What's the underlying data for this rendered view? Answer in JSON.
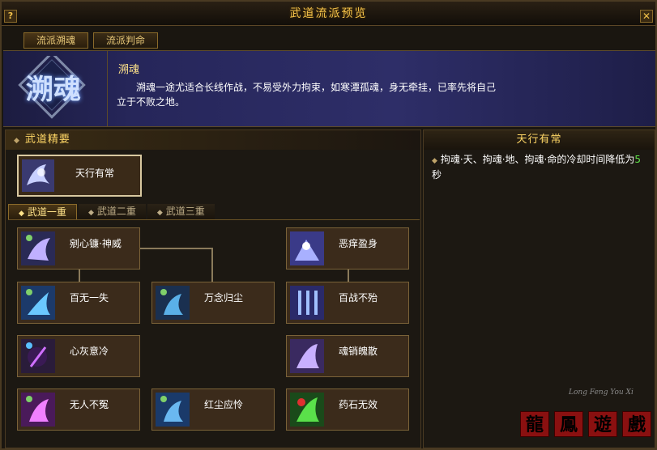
{
  "window": {
    "title": "武道流派预览",
    "help_label": "?",
    "close_label": "✕"
  },
  "tabs": [
    {
      "label": "流派溯魂",
      "active": true
    },
    {
      "label": "流派判命",
      "active": false
    }
  ],
  "school": {
    "emblem_text": "溯魂",
    "name": "溯魂",
    "description": "溯魂一途尤适合长线作战，不易受外力拘束，如寒潭孤魂，身无牵挂，已率先将自己立于不败之地。"
  },
  "essence": {
    "header": "武道精要",
    "card_label": "天行有常"
  },
  "sub_tabs": [
    {
      "label": "武道一重",
      "active": true
    },
    {
      "label": "武道二重",
      "active": false
    },
    {
      "label": "武道三重",
      "active": false
    }
  ],
  "skills": [
    {
      "label": "剜心镰·神威"
    },
    {
      "label": "恶痒盈身"
    },
    {
      "label": "百无一失"
    },
    {
      "label": "万念归尘"
    },
    {
      "label": "百战不殆"
    },
    {
      "label": "心灰意冷"
    },
    {
      "label": "魂销魄散"
    },
    {
      "label": "无人不冤"
    },
    {
      "label": "红尘应怜"
    },
    {
      "label": "药石无效"
    }
  ],
  "detail": {
    "header": "天行有常",
    "text_before": "拘魂·天、拘魂·地、拘魂·命的冷却时间降低为",
    "number": "5",
    "text_after": "秒"
  },
  "watermark": {
    "latin": "Long Feng You Xi",
    "chars": [
      "龍",
      "鳳",
      "遊",
      "戲"
    ]
  },
  "colors": {
    "title_gold": "#f2c14a",
    "banner_blue": "#2e2e68",
    "highlight_green": "#5fe04a"
  }
}
